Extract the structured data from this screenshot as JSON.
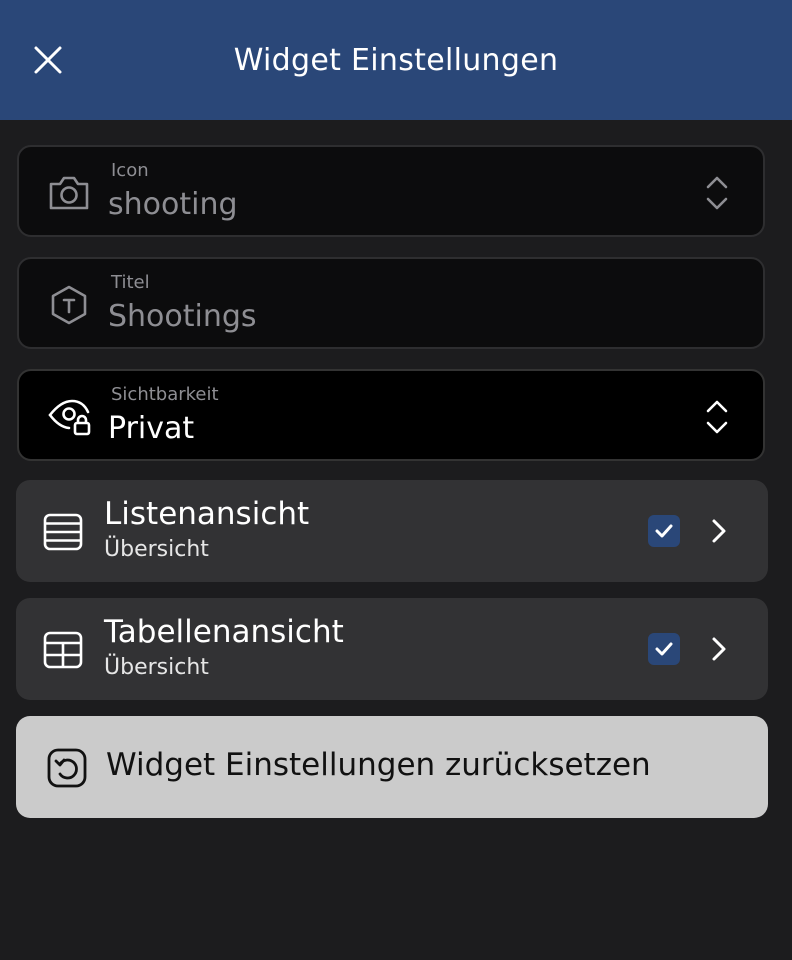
{
  "header": {
    "title": "Widget Einstellungen",
    "close_icon": "close-icon"
  },
  "fields": {
    "icon": {
      "label": "Icon",
      "value": "shooting",
      "icon": "camera-icon"
    },
    "title": {
      "label": "Titel",
      "value": "Shootings",
      "icon": "title-hexagon-icon"
    },
    "visibility": {
      "label": "Sichtbarkeit",
      "value": "Privat",
      "icon": "eye-lock-icon"
    }
  },
  "views": [
    {
      "title": "Listenansicht",
      "subtitle": "Übersicht",
      "checked": true,
      "icon": "list-icon"
    },
    {
      "title": "Tabellenansicht",
      "subtitle": "Übersicht",
      "checked": true,
      "icon": "table-icon"
    }
  ],
  "reset": {
    "label": "Widget Einstellungen zurücksetzen",
    "icon": "reset-icon"
  },
  "colors": {
    "header": "#2a4778",
    "background": "#1c1c1e",
    "checkbox": "#2a4778",
    "reset_button": "#cbcbcb"
  }
}
